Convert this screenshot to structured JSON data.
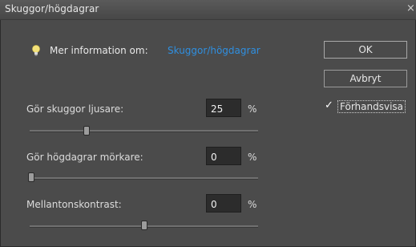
{
  "title": "Skuggor/högdagrar",
  "info": {
    "text": "Mer information om:",
    "link": "Skuggor/högdagrar",
    "icon": "lightbulb-icon"
  },
  "buttons": {
    "ok": "OK",
    "cancel": "Avbryt"
  },
  "preview": {
    "label": "Förhandsvisa",
    "checked": true
  },
  "controls": [
    {
      "label": "Gör skuggor ljusare:",
      "value": "25",
      "unit": "%",
      "slider_fraction": 0.25
    },
    {
      "label": "Gör högdagrar mörkare:",
      "value": "0",
      "unit": "%",
      "slider_fraction": 0.0
    },
    {
      "label": "Mellantonskontrast:",
      "value": "0",
      "unit": "%",
      "slider_fraction": 0.5
    }
  ]
}
